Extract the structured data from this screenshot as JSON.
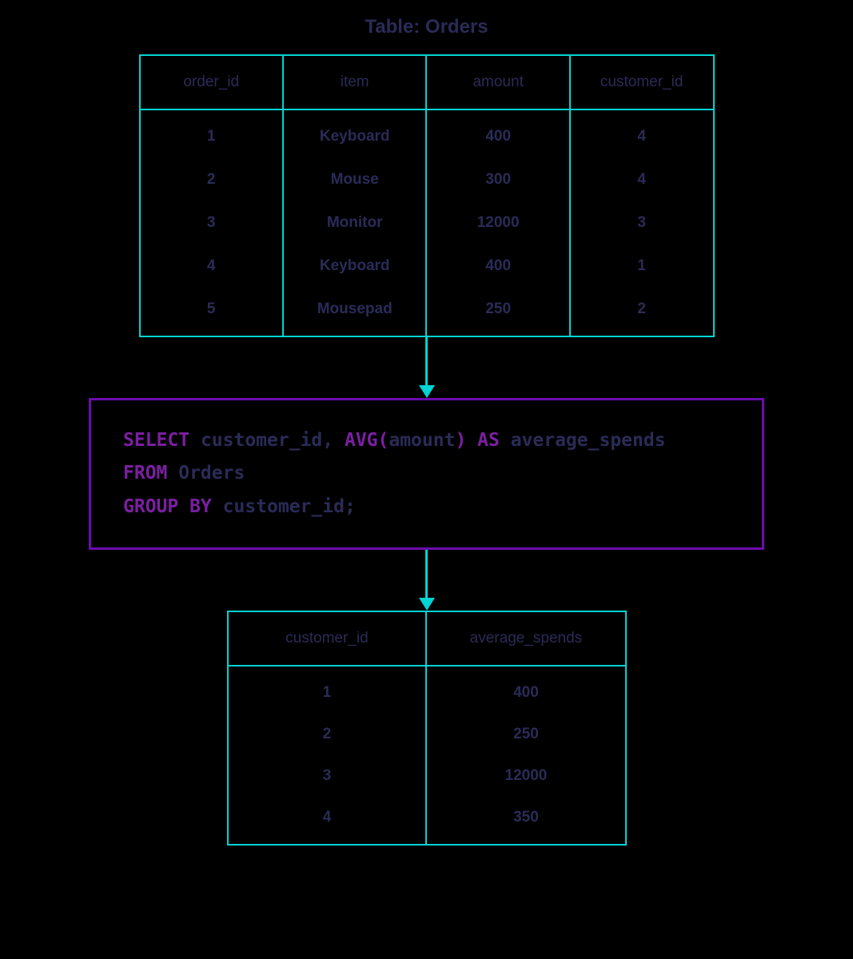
{
  "title": "Table: Orders",
  "orders_table": {
    "headers": [
      "order_id",
      "item",
      "amount",
      "customer_id"
    ],
    "rows": [
      [
        "1",
        "Keyboard",
        "400",
        "4"
      ],
      [
        "2",
        "Mouse",
        "300",
        "4"
      ],
      [
        "3",
        "Monitor",
        "12000",
        "3"
      ],
      [
        "4",
        "Keyboard",
        "400",
        "1"
      ],
      [
        "5",
        "Mousepad",
        "250",
        "2"
      ]
    ]
  },
  "sql": {
    "line1": {
      "kw1": "SELECT",
      "t1": " customer_id, ",
      "kw2": "AVG(",
      "t2": "amount",
      "kw3": ") AS",
      "t3": " average_spends"
    },
    "line2": {
      "kw1": "FROM",
      "t1": " Orders"
    },
    "line3": {
      "kw1": "GROUP BY",
      "t1": " customer_id;"
    }
  },
  "result_table": {
    "headers": [
      "customer_id",
      "average_spends"
    ],
    "rows": [
      [
        "1",
        "400"
      ],
      [
        "2",
        "250"
      ],
      [
        "3",
        "12000"
      ],
      [
        "4",
        "350"
      ]
    ]
  },
  "colors": {
    "teal": "#00d4d4",
    "purple": "#6a0dad",
    "navy": "#2a2b57"
  }
}
